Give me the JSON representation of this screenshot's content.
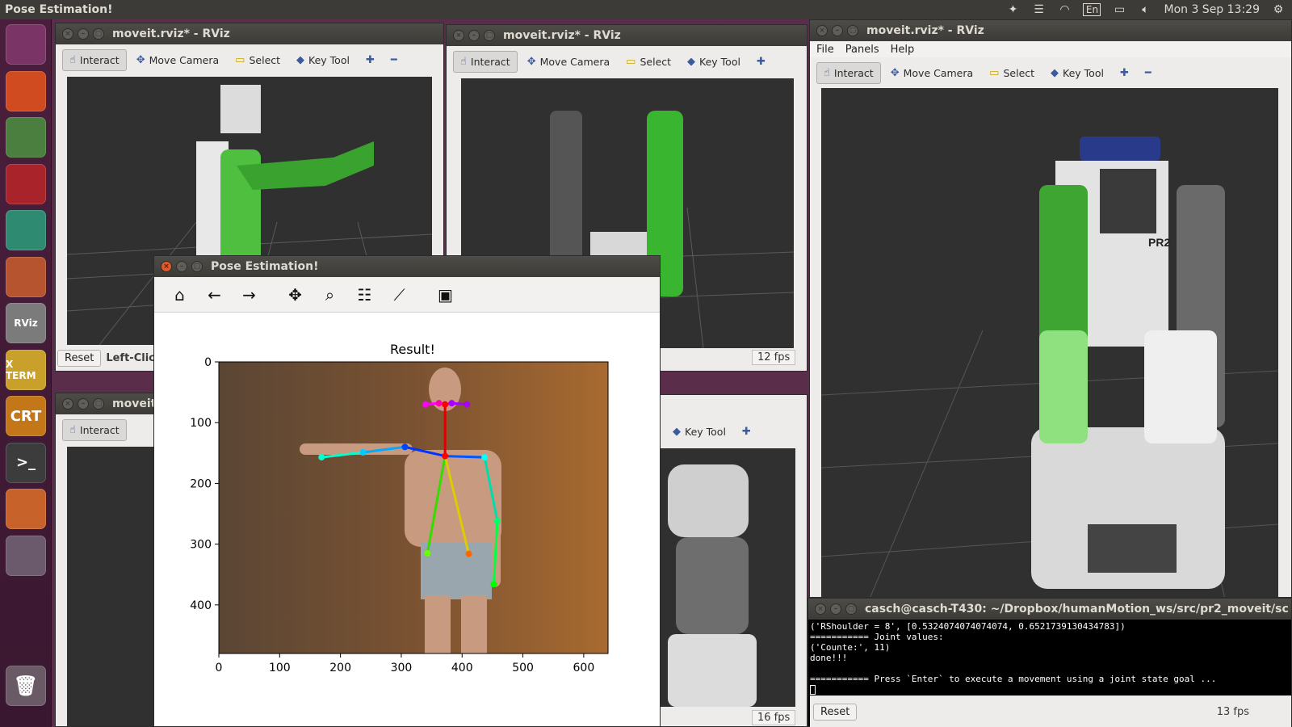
{
  "top_panel": {
    "title": "Pose Estimation!",
    "keyboard": "En",
    "clock": "Mon 3 Sep 13:29",
    "icons": [
      "dropbox-icon",
      "menu-icon",
      "wifi-icon",
      "keyboard-icon",
      "battery-icon",
      "volume-icon",
      "gear-icon"
    ]
  },
  "launcher": {
    "items": [
      {
        "name": "ubuntu-home",
        "label": "",
        "color": "#7a3566"
      },
      {
        "name": "firefox",
        "label": "",
        "color": "#d04b1f"
      },
      {
        "name": "chrome",
        "label": "",
        "color": "#4a7f3f"
      },
      {
        "name": "screenshot",
        "label": "",
        "color": "#a8242a"
      },
      {
        "name": "atom",
        "label": "",
        "color": "#2f8a72"
      },
      {
        "name": "files",
        "label": "",
        "color": "#b5542f"
      },
      {
        "name": "rviz",
        "label": "RViz",
        "color": "#7b7b7b"
      },
      {
        "name": "xterm",
        "label": "X TERM",
        "color": "#c9a12a"
      },
      {
        "name": "crt",
        "label": "CRT",
        "color": "#c47718"
      },
      {
        "name": "terminal",
        "label": ">_",
        "color": "#3c3c3c"
      },
      {
        "name": "pinwheel",
        "label": "",
        "color": "#c7622a"
      },
      {
        "name": "phone",
        "label": "",
        "color": "#6b5a6b"
      }
    ],
    "trash_label": ""
  },
  "rviz_windows": {
    "top_left": {
      "title": "moveit.rviz* - RViz"
    },
    "top_middle": {
      "title": "moveit.rviz* - RViz",
      "fps": "12 fps"
    },
    "right": {
      "title": "moveit.rviz* - RViz",
      "fps": "13 fps"
    },
    "bottom_left": {
      "title": "moveit"
    },
    "bottom_middle_fps": "16 fps"
  },
  "rviz_menu": {
    "file": "File",
    "panels": "Panels",
    "help": "Help"
  },
  "rviz_tools": {
    "interact": "Interact",
    "move_camera": "Move Camera",
    "select": "Select",
    "key_tool": "Key Tool",
    "reset": "Reset",
    "left_click": "Left-Click"
  },
  "robot": {
    "badge": "PR2"
  },
  "pose_window": {
    "title": "Pose Estimation!",
    "toolbar": [
      "home-icon",
      "back-icon",
      "forward-icon",
      "pan-icon",
      "zoom-icon",
      "configure-icon",
      "edit-curve-icon",
      "save-icon"
    ]
  },
  "chart_data": {
    "type": "image",
    "title": "Result!",
    "xlim": [
      0,
      640
    ],
    "ylim": [
      480,
      0
    ],
    "xticks": [
      "0",
      "100",
      "200",
      "300",
      "400",
      "500",
      "600"
    ],
    "yticks": [
      "0",
      "100",
      "200",
      "300",
      "400"
    ],
    "keypoints": [
      {
        "name": "nose",
        "x": 372,
        "y": 70,
        "color": "#ff0000"
      },
      {
        "name": "neck",
        "x": 372,
        "y": 155,
        "color": "#ff0000"
      },
      {
        "name": "r_eye",
        "x": 362,
        "y": 68,
        "color": "#ff00aa"
      },
      {
        "name": "l_eye",
        "x": 383,
        "y": 68,
        "color": "#aa00ff"
      },
      {
        "name": "r_ear",
        "x": 340,
        "y": 70,
        "color": "#ff00ff"
      },
      {
        "name": "l_ear",
        "x": 408,
        "y": 70,
        "color": "#aa00ff"
      },
      {
        "name": "r_shoulder",
        "x": 306,
        "y": 140,
        "color": "#0044ff"
      },
      {
        "name": "r_elbow",
        "x": 237,
        "y": 149,
        "color": "#00ccff"
      },
      {
        "name": "r_wrist",
        "x": 169,
        "y": 157,
        "color": "#00ffcc"
      },
      {
        "name": "l_shoulder",
        "x": 437,
        "y": 157,
        "color": "#00ffff"
      },
      {
        "name": "l_elbow",
        "x": 458,
        "y": 262,
        "color": "#00ff66"
      },
      {
        "name": "l_wrist",
        "x": 452,
        "y": 366,
        "color": "#00ff00"
      },
      {
        "name": "r_hip",
        "x": 343,
        "y": 315,
        "color": "#66ff00"
      },
      {
        "name": "l_hip",
        "x": 411,
        "y": 316,
        "color": "#ff6600"
      }
    ],
    "limbs": [
      {
        "from": "nose",
        "to": "neck",
        "color": "#dd0000"
      },
      {
        "from": "neck",
        "to": "r_shoulder",
        "color": "#0033ff"
      },
      {
        "from": "r_shoulder",
        "to": "r_elbow",
        "color": "#00aaff"
      },
      {
        "from": "r_elbow",
        "to": "r_wrist",
        "color": "#00ffcc"
      },
      {
        "from": "neck",
        "to": "l_shoulder",
        "color": "#0055ff"
      },
      {
        "from": "l_shoulder",
        "to": "l_elbow",
        "color": "#00ddaa"
      },
      {
        "from": "l_elbow",
        "to": "l_wrist",
        "color": "#00ff44"
      },
      {
        "from": "neck",
        "to": "r_hip",
        "color": "#33dd00"
      },
      {
        "from": "neck",
        "to": "l_hip",
        "color": "#ddcc00"
      },
      {
        "from": "r_eye",
        "to": "nose",
        "color": "#ff00aa"
      },
      {
        "from": "l_eye",
        "to": "nose",
        "color": "#aa00ff"
      },
      {
        "from": "r_ear",
        "to": "r_eye",
        "color": "#ff00ff"
      },
      {
        "from": "l_ear",
        "to": "l_eye",
        "color": "#aa00ff"
      }
    ]
  },
  "terminal": {
    "title": "casch@casch-T430: ~/Dropbox/humanMotion_ws/src/pr2_moveit/sc",
    "lines": [
      "('RShoulder = 8', [0.5324074074074074, 0.6521739130434783])",
      "=========== Joint values:",
      "('Counte:', 11)",
      "done!!!",
      "",
      "=========== Press `Enter` to execute a movement using a joint state goal ..."
    ]
  }
}
